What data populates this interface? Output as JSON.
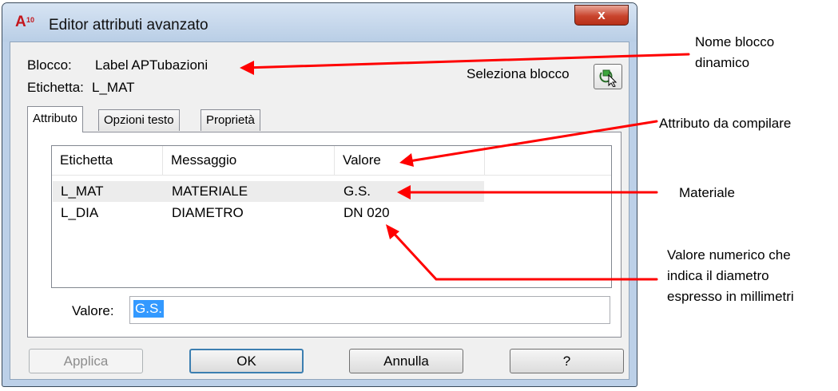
{
  "window": {
    "title": "Editor attributi avanzato",
    "close_label": "x",
    "app_icon": {
      "letter": "A",
      "number": "10"
    }
  },
  "header": {
    "block_label": "Blocco:",
    "block_value": "Label APTubazioni",
    "tag_label": "Etichetta:",
    "tag_value": "L_MAT",
    "select_block_label": "Seleziona blocco",
    "select_block_icon": "select-object-icon"
  },
  "tabs": [
    {
      "label": "Attributo",
      "active": true
    },
    {
      "label": "Opzioni testo",
      "active": false
    },
    {
      "label": "Proprietà",
      "active": false
    }
  ],
  "attribute_list": {
    "columns": [
      "Etichetta",
      "Messaggio",
      "Valore"
    ],
    "rows": [
      {
        "tag": "L_MAT",
        "prompt": "MATERIALE",
        "value": "G.S.",
        "selected": true
      },
      {
        "tag": "L_DIA",
        "prompt": "DIAMETRO",
        "value": "DN 020",
        "selected": false
      }
    ]
  },
  "value_field": {
    "label": "Valore:",
    "value": "G.S."
  },
  "buttons": {
    "apply": "Applica",
    "ok": "OK",
    "cancel": "Annulla",
    "help": "?"
  },
  "annotations": {
    "block_name": [
      "Nome blocco",
      "dinamico"
    ],
    "attribute_to_fill": "Attributo da compilare",
    "material": "Materiale",
    "numeric_value": [
      "Valore numerico che",
      "indica il diametro",
      "espresso in millimetri"
    ],
    "arrow_color": "#ff0000"
  },
  "colors": {
    "title_bar": "#b9cee6",
    "close_button": "#c9442d",
    "selection": "#3399ff",
    "default_button_border": "#3c7fb1"
  }
}
